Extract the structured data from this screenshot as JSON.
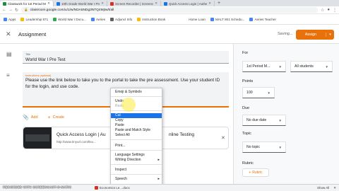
{
  "browser": {
    "tabs": [
      {
        "title": "Classwork for 1st Period MTT",
        "active": true
      },
      {
        "title": "10th Grade World War I Pre-Te",
        "active": false
      },
      {
        "title": "Screen Recorder | Screencast",
        "active": false
      },
      {
        "title": "Quick Access Login | Authenti",
        "active": false
      }
    ],
    "new_tab": "+",
    "url": "classroom.google.com/u/1/w/NDA5NDg3NTQ4MjIw/t/all",
    "bookmarks": [
      "Apps",
      "Leadership 871",
      "World War I Docu...",
      "Aeries",
      "Adjunct Info",
      "Instruction Book",
      "Home Loan",
      "MALT 801 Schedu...",
      "Aeries Teacher"
    ]
  },
  "header": {
    "title": "Assignment",
    "status": "Saving...",
    "assign_label": "Assign",
    "assign_dropdown": "▾"
  },
  "main": {
    "title_label": "Title",
    "title_value": "World War I Pre Test",
    "instructions_label": "Instructions (optional)",
    "instructions_value": "Please use the link below to take you to the portal to take the pre assessment. Use your student ID for the login, and use code.",
    "add_label": "Add",
    "create_label": "Create",
    "attachment_title": "Quick Access Login | Au",
    "attachment_title_tail": "nline Testing",
    "attachment_url": "http://www.tinyurl.com/tlsu..."
  },
  "context_menu": {
    "items": [
      {
        "label": "Emoji & Symbols",
        "state": "normal"
      },
      {
        "label": "Undo",
        "state": "normal"
      },
      {
        "label": "Redo",
        "state": "disabled"
      },
      {
        "label": "Cut",
        "state": "highlighted"
      },
      {
        "label": "Copy",
        "state": "normal"
      },
      {
        "label": "Paste",
        "state": "normal"
      },
      {
        "label": "Paste and Match Style",
        "state": "normal"
      },
      {
        "label": "Select All",
        "state": "normal"
      },
      {
        "label": "Print...",
        "state": "normal"
      },
      {
        "label": "Language Settings",
        "state": "normal"
      },
      {
        "label": "Writing Direction",
        "state": "normal",
        "submenu": true
      },
      {
        "label": "Inspect",
        "state": "normal"
      },
      {
        "label": "Speech",
        "state": "normal",
        "submenu": true
      }
    ],
    "submenu_arrow": "▸"
  },
  "right_panel": {
    "for_label": "For",
    "class_value": "1st Period M...",
    "students_value": "All students",
    "points_label": "Points",
    "points_value": "100",
    "due_label": "Due",
    "due_value": "No due date",
    "topic_label": "Topic",
    "topic_value": "No topic",
    "rubric_label": "Rubric",
    "rubric_button": "Rubric"
  },
  "downloads": {
    "item": "Economics Le....docx",
    "show_all": "Show All"
  },
  "watermark": "RECORDED WITH SCREENCAST-O-MATIC",
  "colors": {
    "accent": "#e8710a",
    "highlight": "#1a73e8"
  }
}
